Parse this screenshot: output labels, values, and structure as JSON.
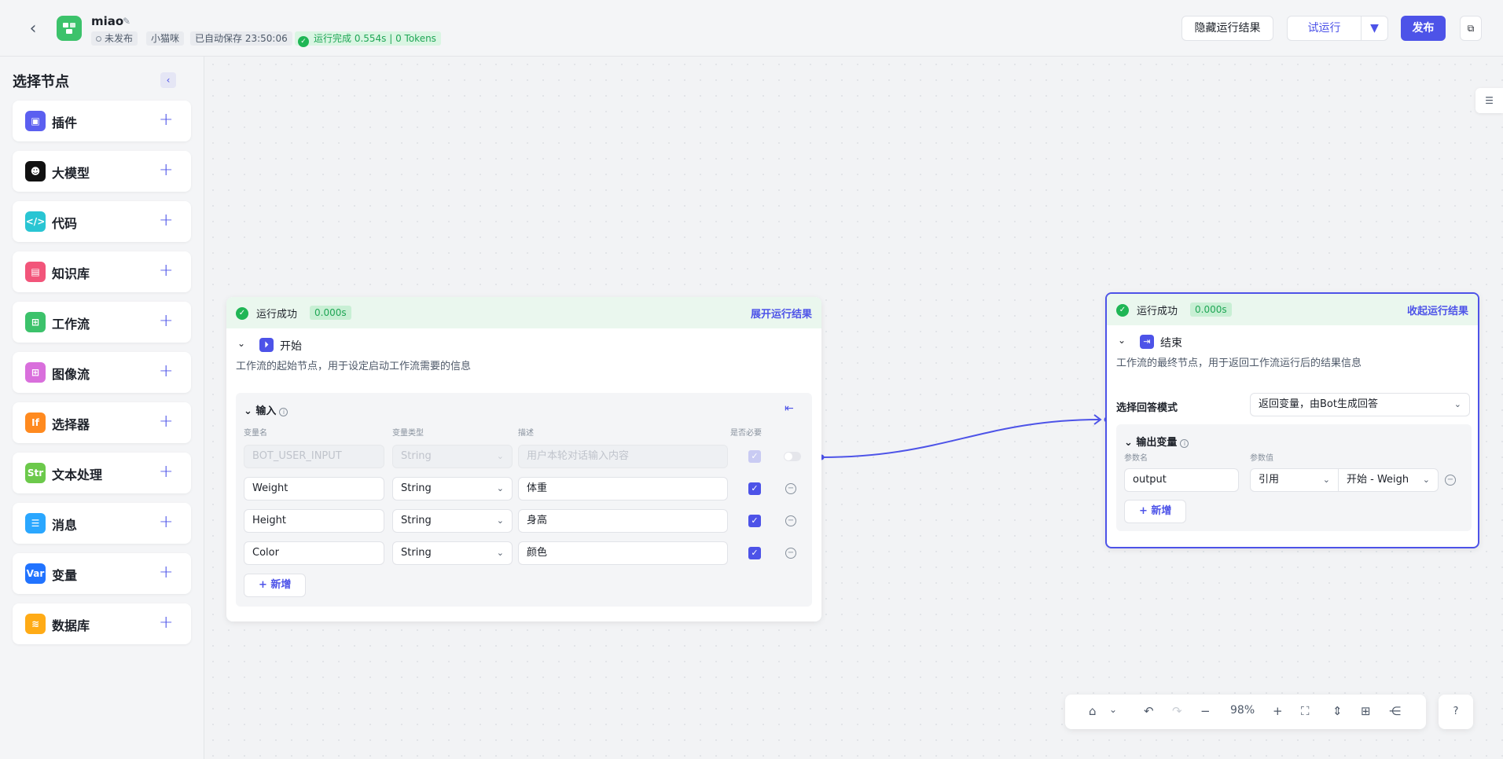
{
  "header": {
    "app_name": "miao",
    "status_unpublished": "未发布",
    "owner": "小猫咪",
    "autosave": "已自动保存 23:50:06",
    "run_status": "运行完成 0.554s | 0 Tokens",
    "hide_results": "隐藏运行结果",
    "test_run": "试运行",
    "publish": "发布"
  },
  "sidebar": {
    "title": "选择节点",
    "items": [
      {
        "label": "插件",
        "color": "#5b5ff0",
        "glyph": "▣"
      },
      {
        "label": "大模型",
        "color": "#111111",
        "glyph": "☻"
      },
      {
        "label": "代码",
        "color": "#29c5d3",
        "glyph": "</>"
      },
      {
        "label": "知识库",
        "color": "#f2557a",
        "glyph": "▤"
      },
      {
        "label": "工作流",
        "color": "#3cc26b",
        "glyph": "⊞"
      },
      {
        "label": "图像流",
        "color": "#d96fdc",
        "glyph": "⊞"
      },
      {
        "label": "选择器",
        "color": "#ff8a1f",
        "glyph": "If"
      },
      {
        "label": "文本处理",
        "color": "#6cc94b",
        "glyph": "Str"
      },
      {
        "label": "消息",
        "color": "#2aa7ff",
        "glyph": "☰"
      },
      {
        "label": "变量",
        "color": "#2173ff",
        "glyph": "Var"
      },
      {
        "label": "数据库",
        "color": "#ffab16",
        "glyph": "≋"
      }
    ]
  },
  "start_node": {
    "run_status": "运行成功",
    "run_time": "0.000s",
    "toggle_results": "展开运行结果",
    "title": "开始",
    "description": "工作流的起始节点，用于设定启动工作流需要的信息",
    "input_section": "输入",
    "col_name": "变量名",
    "col_type": "变量类型",
    "col_desc": "描述",
    "col_required": "是否必要",
    "rows": [
      {
        "name": "BOT_USER_INPUT",
        "type": "String",
        "desc": "用户本轮对话输入内容"
      },
      {
        "name": "Weight",
        "type": "String",
        "desc": "体重"
      },
      {
        "name": "Height",
        "type": "String",
        "desc": "身高"
      },
      {
        "name": "Color",
        "type": "String",
        "desc": "颜色"
      }
    ],
    "add_label": "新增"
  },
  "end_node": {
    "run_status": "运行成功",
    "run_time": "0.000s",
    "toggle_results": "收起运行结果",
    "title": "结束",
    "description": "工作流的最终节点，用于返回工作流运行后的结果信息",
    "mode_label": "选择回答模式",
    "mode_value": "返回变量，由Bot生成回答",
    "output_section": "输出变量",
    "col_param": "参数名",
    "col_value": "参数值",
    "output_name": "output",
    "ref_type": "引用",
    "ref_value": "开始 - Weigh",
    "add_label": "新增"
  },
  "toolbar": {
    "zoom": "98%"
  },
  "colors": {
    "accent": "#4d53e8",
    "success": "#1fb655"
  }
}
